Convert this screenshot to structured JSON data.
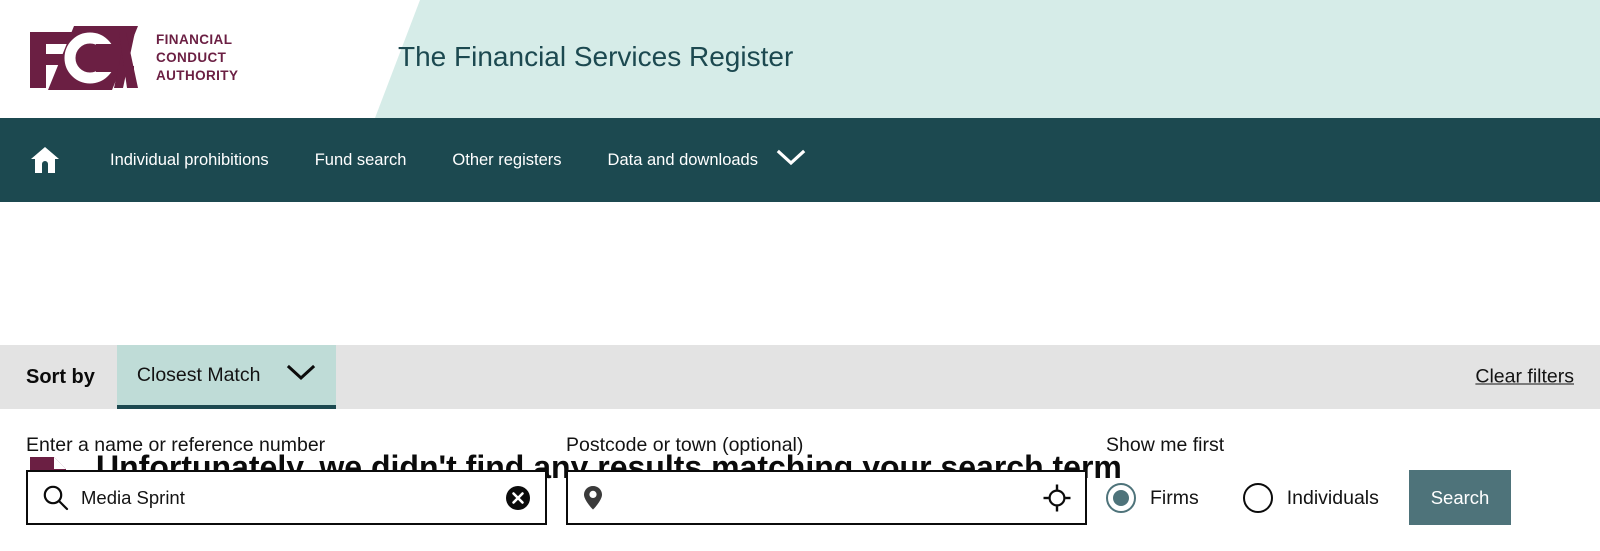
{
  "header": {
    "logo": {
      "mark_text": "FCA",
      "words": "FINANCIAL\nCONDUCT\nAUTHORITY",
      "color": "#6b1f43"
    },
    "title": "The Financial Services Register",
    "band_color": "#d6ece8",
    "title_color": "#1c4950"
  },
  "nav": {
    "background": "#1c4950",
    "home_icon": "home-icon",
    "items": [
      {
        "label": "Individual prohibitions",
        "has_chevron": false
      },
      {
        "label": "Fund search",
        "has_chevron": false
      },
      {
        "label": "Other registers",
        "has_chevron": false
      },
      {
        "label": "Data and downloads",
        "has_chevron": true
      }
    ]
  },
  "search": {
    "name_field": {
      "label": "Enter a name or reference number",
      "value": "Media Sprint",
      "placeholder": "",
      "left_icon": "search-icon",
      "right_icon": "clear-icon"
    },
    "postcode_field": {
      "label": "Postcode or town (optional)",
      "value": "",
      "placeholder": "",
      "left_icon": "map-pin-icon",
      "right_icon": "locate-crosshair-icon"
    },
    "show_me_first": {
      "label": "Show me first",
      "options": [
        {
          "label": "Firms",
          "selected": true
        },
        {
          "label": "Individuals",
          "selected": false
        }
      ]
    },
    "search_button": {
      "label": "Search",
      "color": "#4e737a"
    }
  },
  "sortbar": {
    "label": "Sort by",
    "selected_option": "Closest Match",
    "options": [
      "Closest Match"
    ],
    "clear_filters": "Clear filters",
    "background": "#e3e3e3",
    "select_background": "#bfdcd7",
    "underline_color": "#1c4950"
  },
  "results": {
    "icon": "document-search-icon",
    "icon_color": "#6b1f43",
    "message": "Unfortunately, we didn't find any results matching your search term"
  }
}
